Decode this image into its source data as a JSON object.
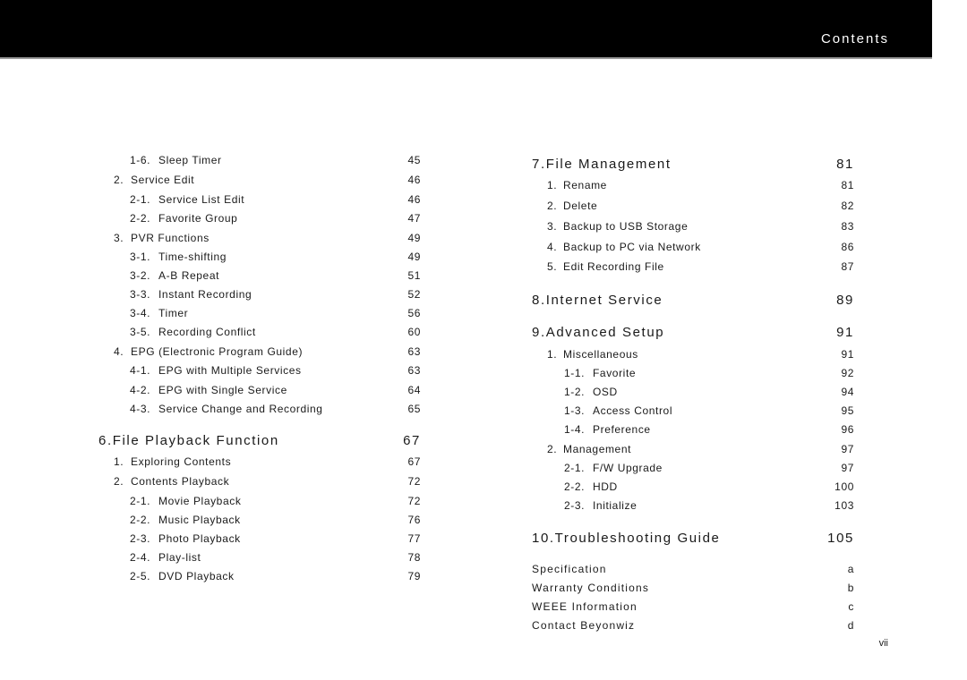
{
  "header": {
    "title": "Contents"
  },
  "left_column": [
    {
      "level": 2,
      "num": "1-6.",
      "label": "Sleep Timer",
      "page": "45"
    },
    {
      "level": 1,
      "num": "2.",
      "label": "Service Edit",
      "page": "46"
    },
    {
      "level": 2,
      "num": "2-1.",
      "label": "Service List Edit",
      "page": "46"
    },
    {
      "level": 2,
      "num": "2-2.",
      "label": "Favorite Group",
      "page": "47"
    },
    {
      "level": 1,
      "num": "3.",
      "label": "PVR Functions",
      "page": "49"
    },
    {
      "level": 2,
      "num": "3-1.",
      "label": "Time-shifting",
      "page": "49"
    },
    {
      "level": 2,
      "num": "3-2.",
      "label": "A-B Repeat",
      "page": "51"
    },
    {
      "level": 2,
      "num": "3-3.",
      "label": "Instant Recording",
      "page": "52"
    },
    {
      "level": 2,
      "num": "3-4.",
      "label": "Timer",
      "page": "56"
    },
    {
      "level": 2,
      "num": "3-5.",
      "label": "Recording Conflict",
      "page": "60"
    },
    {
      "level": 1,
      "num": "4.",
      "label": "EPG (Electronic Program Guide)",
      "page": "63"
    },
    {
      "level": 2,
      "num": "4-1.",
      "label": "EPG with Multiple Services",
      "page": "63"
    },
    {
      "level": 2,
      "num": "4-2.",
      "label": "EPG with Single Service",
      "page": "64"
    },
    {
      "level": 2,
      "num": "4-3.",
      "label": "Service Change and Recording",
      "page": "65"
    },
    {
      "level": 0,
      "num": "6.",
      "label": "File Playback Function",
      "page": "67"
    },
    {
      "level": 1,
      "num": "1.",
      "label": "Exploring Contents",
      "page": "67"
    },
    {
      "level": 1,
      "num": "2.",
      "label": "Contents Playback",
      "page": "72"
    },
    {
      "level": 2,
      "num": "2-1.",
      "label": "Movie Playback",
      "page": "72"
    },
    {
      "level": 2,
      "num": "2-2.",
      "label": "Music Playback",
      "page": "76"
    },
    {
      "level": 2,
      "num": "2-3.",
      "label": "Photo Playback",
      "page": "77"
    },
    {
      "level": 2,
      "num": "2-4.",
      "label": "Play-list",
      "page": "78"
    },
    {
      "level": 2,
      "num": "2-5.",
      "label": "DVD Playback",
      "page": "79"
    }
  ],
  "right_column": [
    {
      "level": 0,
      "num": "7.",
      "label": "File Management",
      "page": "81"
    },
    {
      "level": 1,
      "num": "1.",
      "label": "Rename",
      "page": "81"
    },
    {
      "level": 1,
      "num": "2.",
      "label": "Delete",
      "page": "82"
    },
    {
      "level": 1,
      "num": "3.",
      "label": "Backup to USB Storage",
      "page": "83"
    },
    {
      "level": 1,
      "num": "4.",
      "label": "Backup to PC via Network",
      "page": "86"
    },
    {
      "level": 1,
      "num": "5.",
      "label": "Edit Recording File",
      "page": "87"
    },
    {
      "level": 0,
      "num": "8.",
      "label": "Internet Service",
      "page": "89"
    },
    {
      "level": 0,
      "num": "9.",
      "label": "Advanced Setup",
      "page": "91"
    },
    {
      "level": 1,
      "num": "1.",
      "label": "Miscellaneous",
      "page": "91"
    },
    {
      "level": 2,
      "num": "1-1.",
      "label": "Favorite",
      "page": "92"
    },
    {
      "level": 2,
      "num": "1-2.",
      "label": "OSD",
      "page": "94"
    },
    {
      "level": 2,
      "num": "1-3.",
      "label": "Access Control",
      "page": "95"
    },
    {
      "level": 2,
      "num": "1-4.",
      "label": "Preference",
      "page": "96"
    },
    {
      "level": 1,
      "num": "2.",
      "label": "Management",
      "page": "97"
    },
    {
      "level": 2,
      "num": "2-1.",
      "label": "F/W Upgrade",
      "page": "97"
    },
    {
      "level": 2,
      "num": "2-2.",
      "label": "HDD",
      "page": "100"
    },
    {
      "level": 2,
      "num": "2-3.",
      "label": "Initialize",
      "page": "103"
    },
    {
      "level": 0,
      "num": "10.",
      "label": "Troubleshooting Guide",
      "page": "105"
    }
  ],
  "appendix": [
    {
      "label": "Specification",
      "page": "a"
    },
    {
      "label": "Warranty Conditions",
      "page": "b"
    },
    {
      "label": "WEEE Information",
      "page": "c"
    },
    {
      "label": "Contact Beyonwiz",
      "page": "d"
    }
  ],
  "footer": {
    "page_number": "vii"
  }
}
